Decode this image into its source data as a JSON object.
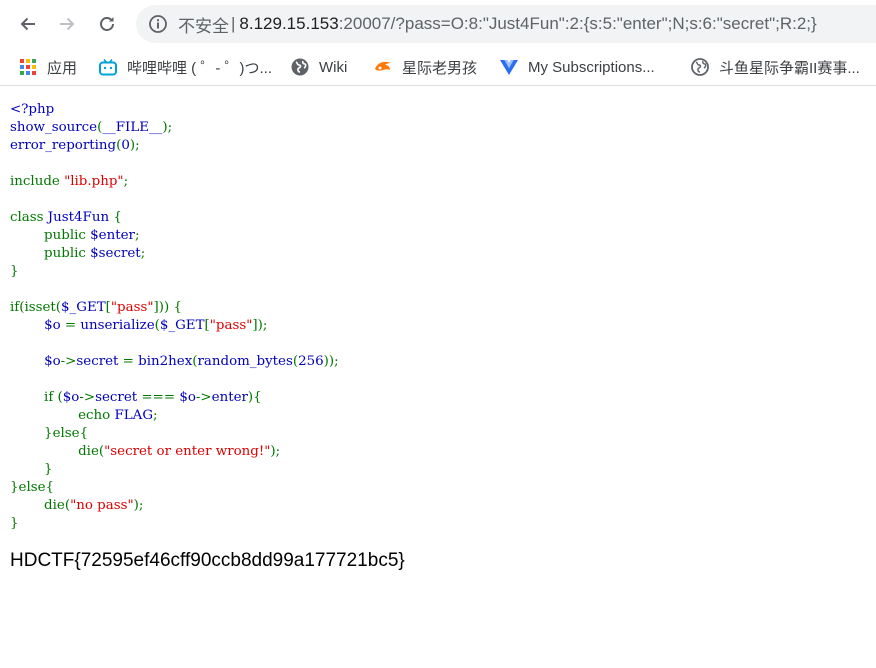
{
  "toolbar": {
    "security_label": "不安全",
    "separator": "|",
    "url_host": "8.129.15.153",
    "url_rest": ":20007/?pass=O:8:\"Just4Fun\":2:{s:5:\"enter\";N;s:6:\"secret\";R:2;}"
  },
  "bookmarks": [
    {
      "label": "应用",
      "icon": "apps-grid-icon"
    },
    {
      "label": "哔哩哔哩 ( ゜- ゜)つ...",
      "icon": "bilibili-icon"
    },
    {
      "label": "Wiki",
      "icon": "globe-icon"
    },
    {
      "label": "星际老男孩",
      "icon": "douyu-icon"
    },
    {
      "label": "My Subscriptions...",
      "icon": "vue-icon"
    },
    {
      "label": "斗鱼星际争霸II赛事...",
      "icon": "globe-icon"
    }
  ],
  "code_lines": [
    [
      {
        "t": "<?php",
        "c": "def"
      }
    ],
    [
      {
        "t": "show_source",
        "c": "def"
      },
      {
        "t": "(",
        "c": "kw"
      },
      {
        "t": "__FILE__",
        "c": "def"
      },
      {
        "t": ");",
        "c": "kw"
      }
    ],
    [
      {
        "t": "error_reporting",
        "c": "def"
      },
      {
        "t": "(",
        "c": "kw"
      },
      {
        "t": "0",
        "c": "def"
      },
      {
        "t": ");",
        "c": "kw"
      }
    ],
    [],
    [
      {
        "t": "include ",
        "c": "kw"
      },
      {
        "t": "\"lib.php\"",
        "c": "str"
      },
      {
        "t": ";",
        "c": "kw"
      }
    ],
    [],
    [
      {
        "t": "class ",
        "c": "kw"
      },
      {
        "t": "Just4Fun ",
        "c": "def"
      },
      {
        "t": "{",
        "c": "kw"
      }
    ],
    [
      {
        "t": "        public ",
        "c": "kw"
      },
      {
        "t": "$enter",
        "c": "def"
      },
      {
        "t": ";",
        "c": "kw"
      }
    ],
    [
      {
        "t": "        public ",
        "c": "kw"
      },
      {
        "t": "$secret",
        "c": "def"
      },
      {
        "t": ";",
        "c": "kw"
      }
    ],
    [
      {
        "t": "}",
        "c": "kw"
      }
    ],
    [],
    [
      {
        "t": "if(isset(",
        "c": "kw"
      },
      {
        "t": "$_GET",
        "c": "def"
      },
      {
        "t": "[",
        "c": "kw"
      },
      {
        "t": "\"pass\"",
        "c": "str"
      },
      {
        "t": "])) {",
        "c": "kw"
      }
    ],
    [
      {
        "t": "        ",
        "c": "kw"
      },
      {
        "t": "$o ",
        "c": "def"
      },
      {
        "t": "= ",
        "c": "kw"
      },
      {
        "t": "unserialize",
        "c": "def"
      },
      {
        "t": "(",
        "c": "kw"
      },
      {
        "t": "$_GET",
        "c": "def"
      },
      {
        "t": "[",
        "c": "kw"
      },
      {
        "t": "\"pass\"",
        "c": "str"
      },
      {
        "t": "]);",
        "c": "kw"
      }
    ],
    [],
    [
      {
        "t": "        ",
        "c": "kw"
      },
      {
        "t": "$o",
        "c": "def"
      },
      {
        "t": "->",
        "c": "kw"
      },
      {
        "t": "secret ",
        "c": "def"
      },
      {
        "t": "= ",
        "c": "kw"
      },
      {
        "t": "bin2hex",
        "c": "def"
      },
      {
        "t": "(",
        "c": "kw"
      },
      {
        "t": "random_bytes",
        "c": "def"
      },
      {
        "t": "(",
        "c": "kw"
      },
      {
        "t": "256",
        "c": "def"
      },
      {
        "t": "));",
        "c": "kw"
      }
    ],
    [],
    [
      {
        "t": "        if (",
        "c": "kw"
      },
      {
        "t": "$o",
        "c": "def"
      },
      {
        "t": "->",
        "c": "kw"
      },
      {
        "t": "secret ",
        "c": "def"
      },
      {
        "t": "=== ",
        "c": "kw"
      },
      {
        "t": "$o",
        "c": "def"
      },
      {
        "t": "->",
        "c": "kw"
      },
      {
        "t": "enter",
        "c": "def"
      },
      {
        "t": "){",
        "c": "kw"
      }
    ],
    [
      {
        "t": "                echo ",
        "c": "kw"
      },
      {
        "t": "FLAG",
        "c": "def"
      },
      {
        "t": ";",
        "c": "kw"
      }
    ],
    [
      {
        "t": "        }else{",
        "c": "kw"
      }
    ],
    [
      {
        "t": "                die(",
        "c": "kw"
      },
      {
        "t": "\"secret or enter wrong!\"",
        "c": "str"
      },
      {
        "t": ");",
        "c": "kw"
      }
    ],
    [
      {
        "t": "        }",
        "c": "kw"
      }
    ],
    [
      {
        "t": "}else{",
        "c": "kw"
      }
    ],
    [
      {
        "t": "        die(",
        "c": "kw"
      },
      {
        "t": "\"no pass\"",
        "c": "str"
      },
      {
        "t": ");",
        "c": "kw"
      }
    ],
    [
      {
        "t": "}",
        "c": "kw"
      }
    ]
  ],
  "flag": "HDCTF{72595ef46cff90ccb8dd99a177721bc5}"
}
